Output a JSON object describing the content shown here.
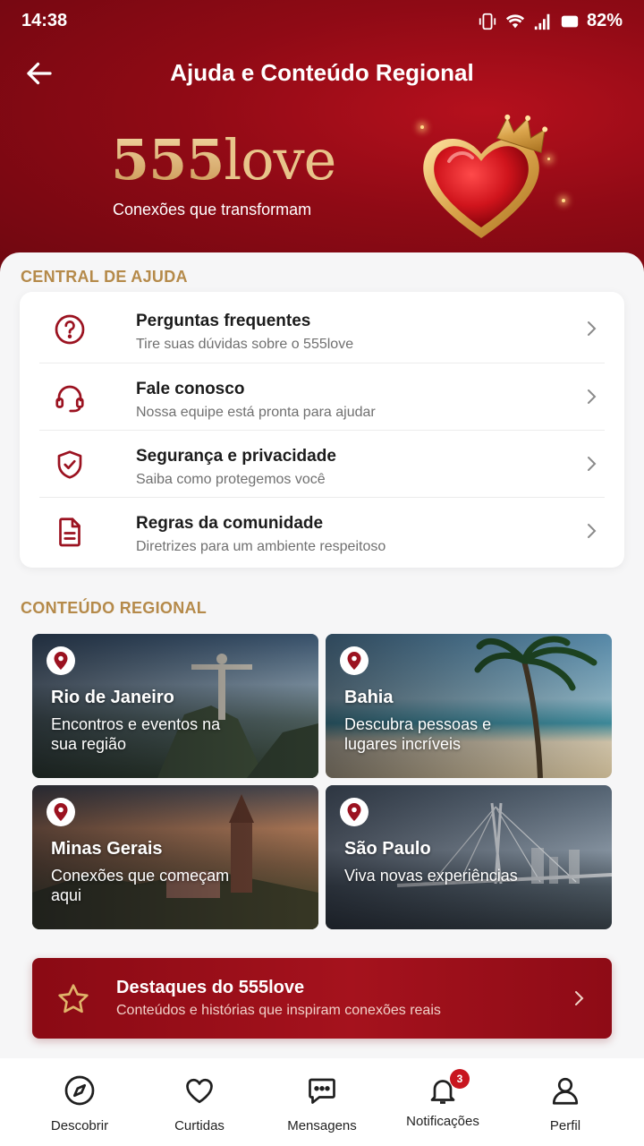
{
  "status_bar": {
    "time": "14:38",
    "battery": "82%"
  },
  "header": {
    "title": "Ajuda e Conteúdo Regional",
    "brand_number": "555",
    "brand_word": "love",
    "tagline": "Conexões que transformam"
  },
  "help_center": {
    "section_title": "CENTRAL DE AJUDA",
    "items": [
      {
        "icon": "question-circle-icon",
        "title": "Perguntas frequentes",
        "subtitle": "Tire suas dúvidas sobre o 555love"
      },
      {
        "icon": "headset-icon",
        "title": "Fale conosco",
        "subtitle": "Nossa equipe está pronta para ajudar"
      },
      {
        "icon": "shield-check-icon",
        "title": "Segurança e privacidade",
        "subtitle": "Saiba como protegemos você"
      },
      {
        "icon": "document-icon",
        "title": "Regras da comunidade",
        "subtitle": "Diretrizes para um ambiente respeitoso"
      }
    ]
  },
  "regional": {
    "section_title": "CONTEÚDO REGIONAL",
    "cards": [
      {
        "name": "Rio de Janeiro",
        "description": "Encontros e eventos na sua região"
      },
      {
        "name": "Bahia",
        "description": "Descubra pessoas e lugares incríveis"
      },
      {
        "name": "Minas Gerais",
        "description": "Conexões que começam aqui"
      },
      {
        "name": "São Paulo",
        "description": "Viva novas experiências"
      }
    ]
  },
  "highlight": {
    "title": "Destaques do 555love",
    "subtitle": "Conteúdos e histórias que inspiram conexões reais"
  },
  "bottom_nav": {
    "items": [
      {
        "label": "Descobrir",
        "icon": "compass-icon"
      },
      {
        "label": "Curtidas",
        "icon": "heart-icon"
      },
      {
        "label": "Mensagens",
        "icon": "chat-icon"
      },
      {
        "label": "Notificações",
        "icon": "bell-icon",
        "badge": "3"
      },
      {
        "label": "Perfil",
        "icon": "user-icon"
      }
    ]
  },
  "colors": {
    "brand_red": "#8f0a15",
    "gold": "#b58a4a",
    "icon_red": "#9b1220"
  }
}
